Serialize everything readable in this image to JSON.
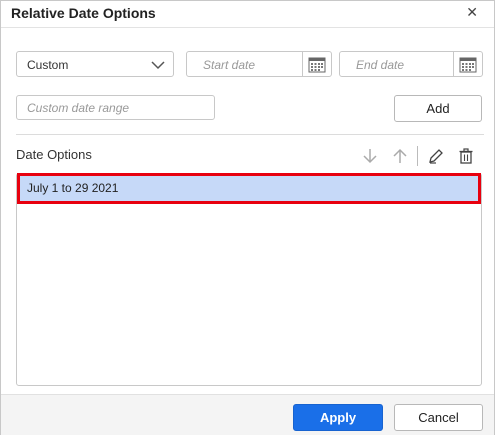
{
  "dialog": {
    "title": "Relative Date Options",
    "close_icon": "close-icon"
  },
  "filters": {
    "type_select": {
      "value": "Custom"
    },
    "start_date": {
      "placeholder": "Start date"
    },
    "end_date": {
      "placeholder": "End date"
    },
    "custom_range": {
      "placeholder": "Custom date range"
    },
    "add_label": "Add"
  },
  "date_options": {
    "label": "Date Options",
    "tools": [
      "move-down-icon",
      "move-up-icon",
      "edit-icon",
      "delete-icon"
    ],
    "items": [
      "July 1 to 29 2021"
    ],
    "selected_index": 0
  },
  "footer": {
    "apply_label": "Apply",
    "cancel_label": "Cancel"
  },
  "colors": {
    "primary": "#1a6fe8",
    "selection": "#c6d9f8",
    "highlight_border": "#e8000f"
  }
}
